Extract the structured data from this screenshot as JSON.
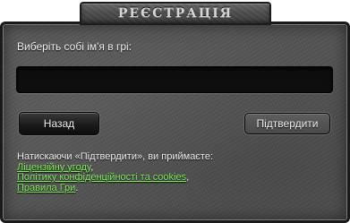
{
  "dialog": {
    "title": "РЕЄСТРАЦІЯ",
    "prompt_label": "Виберіть собі ім'я в грі:",
    "name_input": {
      "value": "",
      "placeholder": ""
    },
    "back_button": "Назад",
    "confirm_button": "Підтвердити",
    "terms": {
      "intro": "Натискаючи «Підтвердити», ви приймаєте:",
      "links": [
        {
          "label": "Ліцензійну угоду",
          "suffix": ","
        },
        {
          "label": "Політику конфіденційності та cookies",
          "suffix": ","
        },
        {
          "label": "Правила Гри",
          "suffix": "."
        }
      ]
    }
  },
  "colors": {
    "panel_background": "#555555",
    "link": "#7ef05a",
    "input_background": "#0e0e0e"
  }
}
